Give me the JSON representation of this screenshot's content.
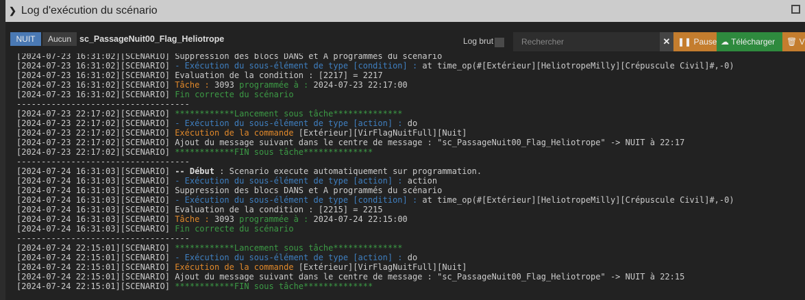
{
  "window": {
    "title": "Log d'exécution du scénario"
  },
  "toolbar": {
    "filter_active": "NUIT",
    "filter_none": "Aucun",
    "scenario_name": "sc_PassageNuit00_Flag_Heliotrope",
    "raw_log_label": "Log brut",
    "raw_log_checked": false,
    "search_placeholder": "Rechercher",
    "clear_label": "✕",
    "pause_label": "Pause",
    "download_label": "Télécharger",
    "clear_log_label": "Vider"
  },
  "colors": {
    "blue": "#3f7fc0",
    "orange": "#e0882a",
    "green": "#3c9a45",
    "pause": "#c47d2e",
    "download": "#2e8a3e",
    "nuit": "#4a79b4"
  },
  "log": [
    [
      [
        "[2024-07-23 16:31:02][SCENARIO] ",
        ""
      ],
      [
        "Suppression des blocs DANS et A programmés du scénario",
        ""
      ]
    ],
    [
      [
        "[2024-07-23 16:31:02][SCENARIO] ",
        ""
      ],
      [
        "- Exécution du sous-élément de type [condition] :",
        "blue"
      ],
      [
        " at time_op(#[Extérieur][HeliotropeMilly][Crépuscule Civil]#,-0)",
        ""
      ]
    ],
    [
      [
        "[2024-07-23 16:31:02][SCENARIO] ",
        ""
      ],
      [
        "Evaluation de la condition : [2217] = 2217",
        ""
      ]
    ],
    [
      [
        "[2024-07-23 16:31:02][SCENARIO] ",
        ""
      ],
      [
        "Tâche :",
        "orange"
      ],
      [
        " 3093 ",
        ""
      ],
      [
        "programmée à :",
        "green"
      ],
      [
        " 2024-07-23 22:17:00",
        ""
      ]
    ],
    [
      [
        "[2024-07-23 16:31:02][SCENARIO] ",
        ""
      ],
      [
        "Fin correcte du scénario",
        "green"
      ]
    ],
    [
      [
        "-----------------------------------",
        ""
      ]
    ],
    [
      [
        "[2024-07-23 22:17:02][SCENARIO] ",
        ""
      ],
      [
        "************Lancement sous tâche**************",
        "green"
      ]
    ],
    [
      [
        "[2024-07-23 22:17:02][SCENARIO] ",
        ""
      ],
      [
        "- Exécution du sous-élément de type [action] :",
        "blue"
      ],
      [
        " do",
        ""
      ]
    ],
    [
      [
        "[2024-07-23 22:17:02][SCENARIO] ",
        ""
      ],
      [
        "Exécution de la commande",
        "orange"
      ],
      [
        " [Extérieur][VirFlagNuitFull][Nuit]",
        ""
      ]
    ],
    [
      [
        "[2024-07-23 22:17:02][SCENARIO] ",
        ""
      ],
      [
        "Ajout du message suivant dans le centre de message : \"sc_PassageNuit00_Flag_Heliotrope\" -> NUIT à 22:17",
        ""
      ]
    ],
    [
      [
        "[2024-07-23 22:17:02][SCENARIO] ",
        ""
      ],
      [
        "************FIN sous tâche**************",
        "green"
      ]
    ],
    [
      [
        "-----------------------------------",
        ""
      ]
    ],
    [
      [
        "[2024-07-24 16:31:03][SCENARIO] ",
        ""
      ],
      [
        "-- Début",
        "bold"
      ],
      [
        " : Scenario execute automatiquement sur programmation.",
        ""
      ]
    ],
    [
      [
        "[2024-07-24 16:31:03][SCENARIO] ",
        ""
      ],
      [
        "- Exécution du sous-élément de type [action] :",
        "blue"
      ],
      [
        " action",
        ""
      ]
    ],
    [
      [
        "[2024-07-24 16:31:03][SCENARIO] ",
        ""
      ],
      [
        "Suppression des blocs DANS et A programmés du scénario",
        ""
      ]
    ],
    [
      [
        "[2024-07-24 16:31:03][SCENARIO] ",
        ""
      ],
      [
        "- Exécution du sous-élément de type [condition] :",
        "blue"
      ],
      [
        " at time_op(#[Extérieur][HeliotropeMilly][Crépuscule Civil]#,-0)",
        ""
      ]
    ],
    [
      [
        "[2024-07-24 16:31:03][SCENARIO] ",
        ""
      ],
      [
        "Evaluation de la condition : [2215] = 2215",
        ""
      ]
    ],
    [
      [
        "[2024-07-24 16:31:03][SCENARIO] ",
        ""
      ],
      [
        "Tâche :",
        "orange"
      ],
      [
        " 3093 ",
        ""
      ],
      [
        "programmée à :",
        "green"
      ],
      [
        " 2024-07-24 22:15:00",
        ""
      ]
    ],
    [
      [
        "[2024-07-24 16:31:03][SCENARIO] ",
        ""
      ],
      [
        "Fin correcte du scénario",
        "green"
      ]
    ],
    [
      [
        "-----------------------------------",
        ""
      ]
    ],
    [
      [
        "[2024-07-24 22:15:01][SCENARIO] ",
        ""
      ],
      [
        "************Lancement sous tâche**************",
        "green"
      ]
    ],
    [
      [
        "[2024-07-24 22:15:01][SCENARIO] ",
        ""
      ],
      [
        "- Exécution du sous-élément de type [action] :",
        "blue"
      ],
      [
        " do",
        ""
      ]
    ],
    [
      [
        "[2024-07-24 22:15:01][SCENARIO] ",
        ""
      ],
      [
        "Exécution de la commande",
        "orange"
      ],
      [
        " [Extérieur][VirFlagNuitFull][Nuit]",
        ""
      ]
    ],
    [
      [
        "[2024-07-24 22:15:01][SCENARIO] ",
        ""
      ],
      [
        "Ajout du message suivant dans le centre de message : \"sc_PassageNuit00_Flag_Heliotrope\" -> NUIT à 22:15",
        ""
      ]
    ],
    [
      [
        "[2024-07-24 22:15:01][SCENARIO] ",
        ""
      ],
      [
        "************FIN sous tâche**************",
        "green"
      ]
    ]
  ]
}
